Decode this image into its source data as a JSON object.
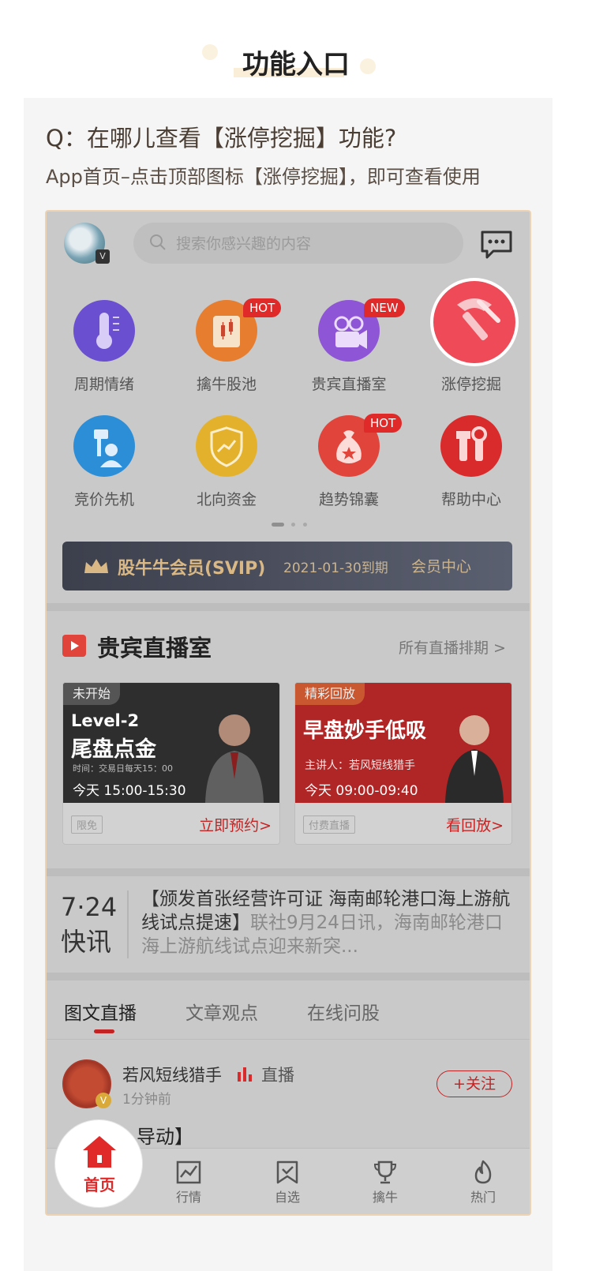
{
  "header": {
    "title": "功能入口"
  },
  "faq": {
    "question": "Q：在哪儿查看【涨停挖掘】功能?",
    "answer": "App首页–点击顶部图标【涨停挖掘】，即可查看使用"
  },
  "app": {
    "search": {
      "placeholder": "搜索你感兴趣的内容",
      "icon": "search-icon"
    },
    "avatar_badge": "V",
    "grid": [
      {
        "label": "周期情绪",
        "icon": "thermometer-icon",
        "color": "#6a4fd1"
      },
      {
        "label": "擒牛股池",
        "icon": "candlestick-icon",
        "color": "#e67d2f",
        "badge": "HOT"
      },
      {
        "label": "贵宾直播室",
        "icon": "video-camera-icon",
        "color": "#8e55d6",
        "badge": "NEW"
      },
      {
        "label": "涨停挖掘",
        "icon": "pickaxe-icon",
        "color": "#ef4a57"
      },
      {
        "label": "竞价先机",
        "icon": "auction-icon",
        "color": "#2d8ed8"
      },
      {
        "label": "北向资金",
        "icon": "shield-chart-icon",
        "color": "#e3b12c"
      },
      {
        "label": "趋势锦囊",
        "icon": "money-bag-icon",
        "color": "#e0443b",
        "badge": "HOT"
      },
      {
        "label": "帮助中心",
        "icon": "tools-icon",
        "color": "#d92b2b"
      }
    ],
    "vip": {
      "title": "股牛牛会员(SVIP)",
      "date": "2021-01-30到期",
      "center": "会员中心"
    },
    "live": {
      "title": "贵宾直播室",
      "all_link": "所有直播排期 >",
      "cards": [
        {
          "tag": "未开始",
          "headline_1": "Level-2",
          "headline_2": "尾盘点金",
          "sub": "时间：交易日每天15：00",
          "time": "今天 15:00-15:30",
          "chip": "限免",
          "action": "立即预约>",
          "theme": "#2e2e2e"
        },
        {
          "tag": "精彩回放",
          "headline_1": "早盘妙手低吸",
          "sub": "主讲人：若风短线猎手",
          "time": "今天 09:00-09:40",
          "chip": "付费直播",
          "action": "看回放>",
          "theme": "#b02525"
        }
      ]
    },
    "news": {
      "logo_line1": "7·24",
      "logo_line2": "快讯",
      "headline": "【颁发首张经营许可证 海南邮轮港口海上游航线试点提速】",
      "body": "联社9月24日讯，海南邮轮港口海上游航线试点迎来新突..."
    },
    "tabs": [
      "图文直播",
      "文章观点",
      "在线问股"
    ],
    "post": {
      "author": "若风短线猎手",
      "live_label": "直播",
      "time": "1分钟前",
      "follow": "+关注",
      "title_visible": "【",
      "title_tail": "导动】"
    },
    "bottom_nav": [
      {
        "label": "首页",
        "icon": "home-icon"
      },
      {
        "label": "行情",
        "icon": "chart-icon"
      },
      {
        "label": "自选",
        "icon": "bookmark-icon"
      },
      {
        "label": "擒牛",
        "icon": "trophy-icon"
      },
      {
        "label": "热门",
        "icon": "fire-icon"
      }
    ]
  }
}
